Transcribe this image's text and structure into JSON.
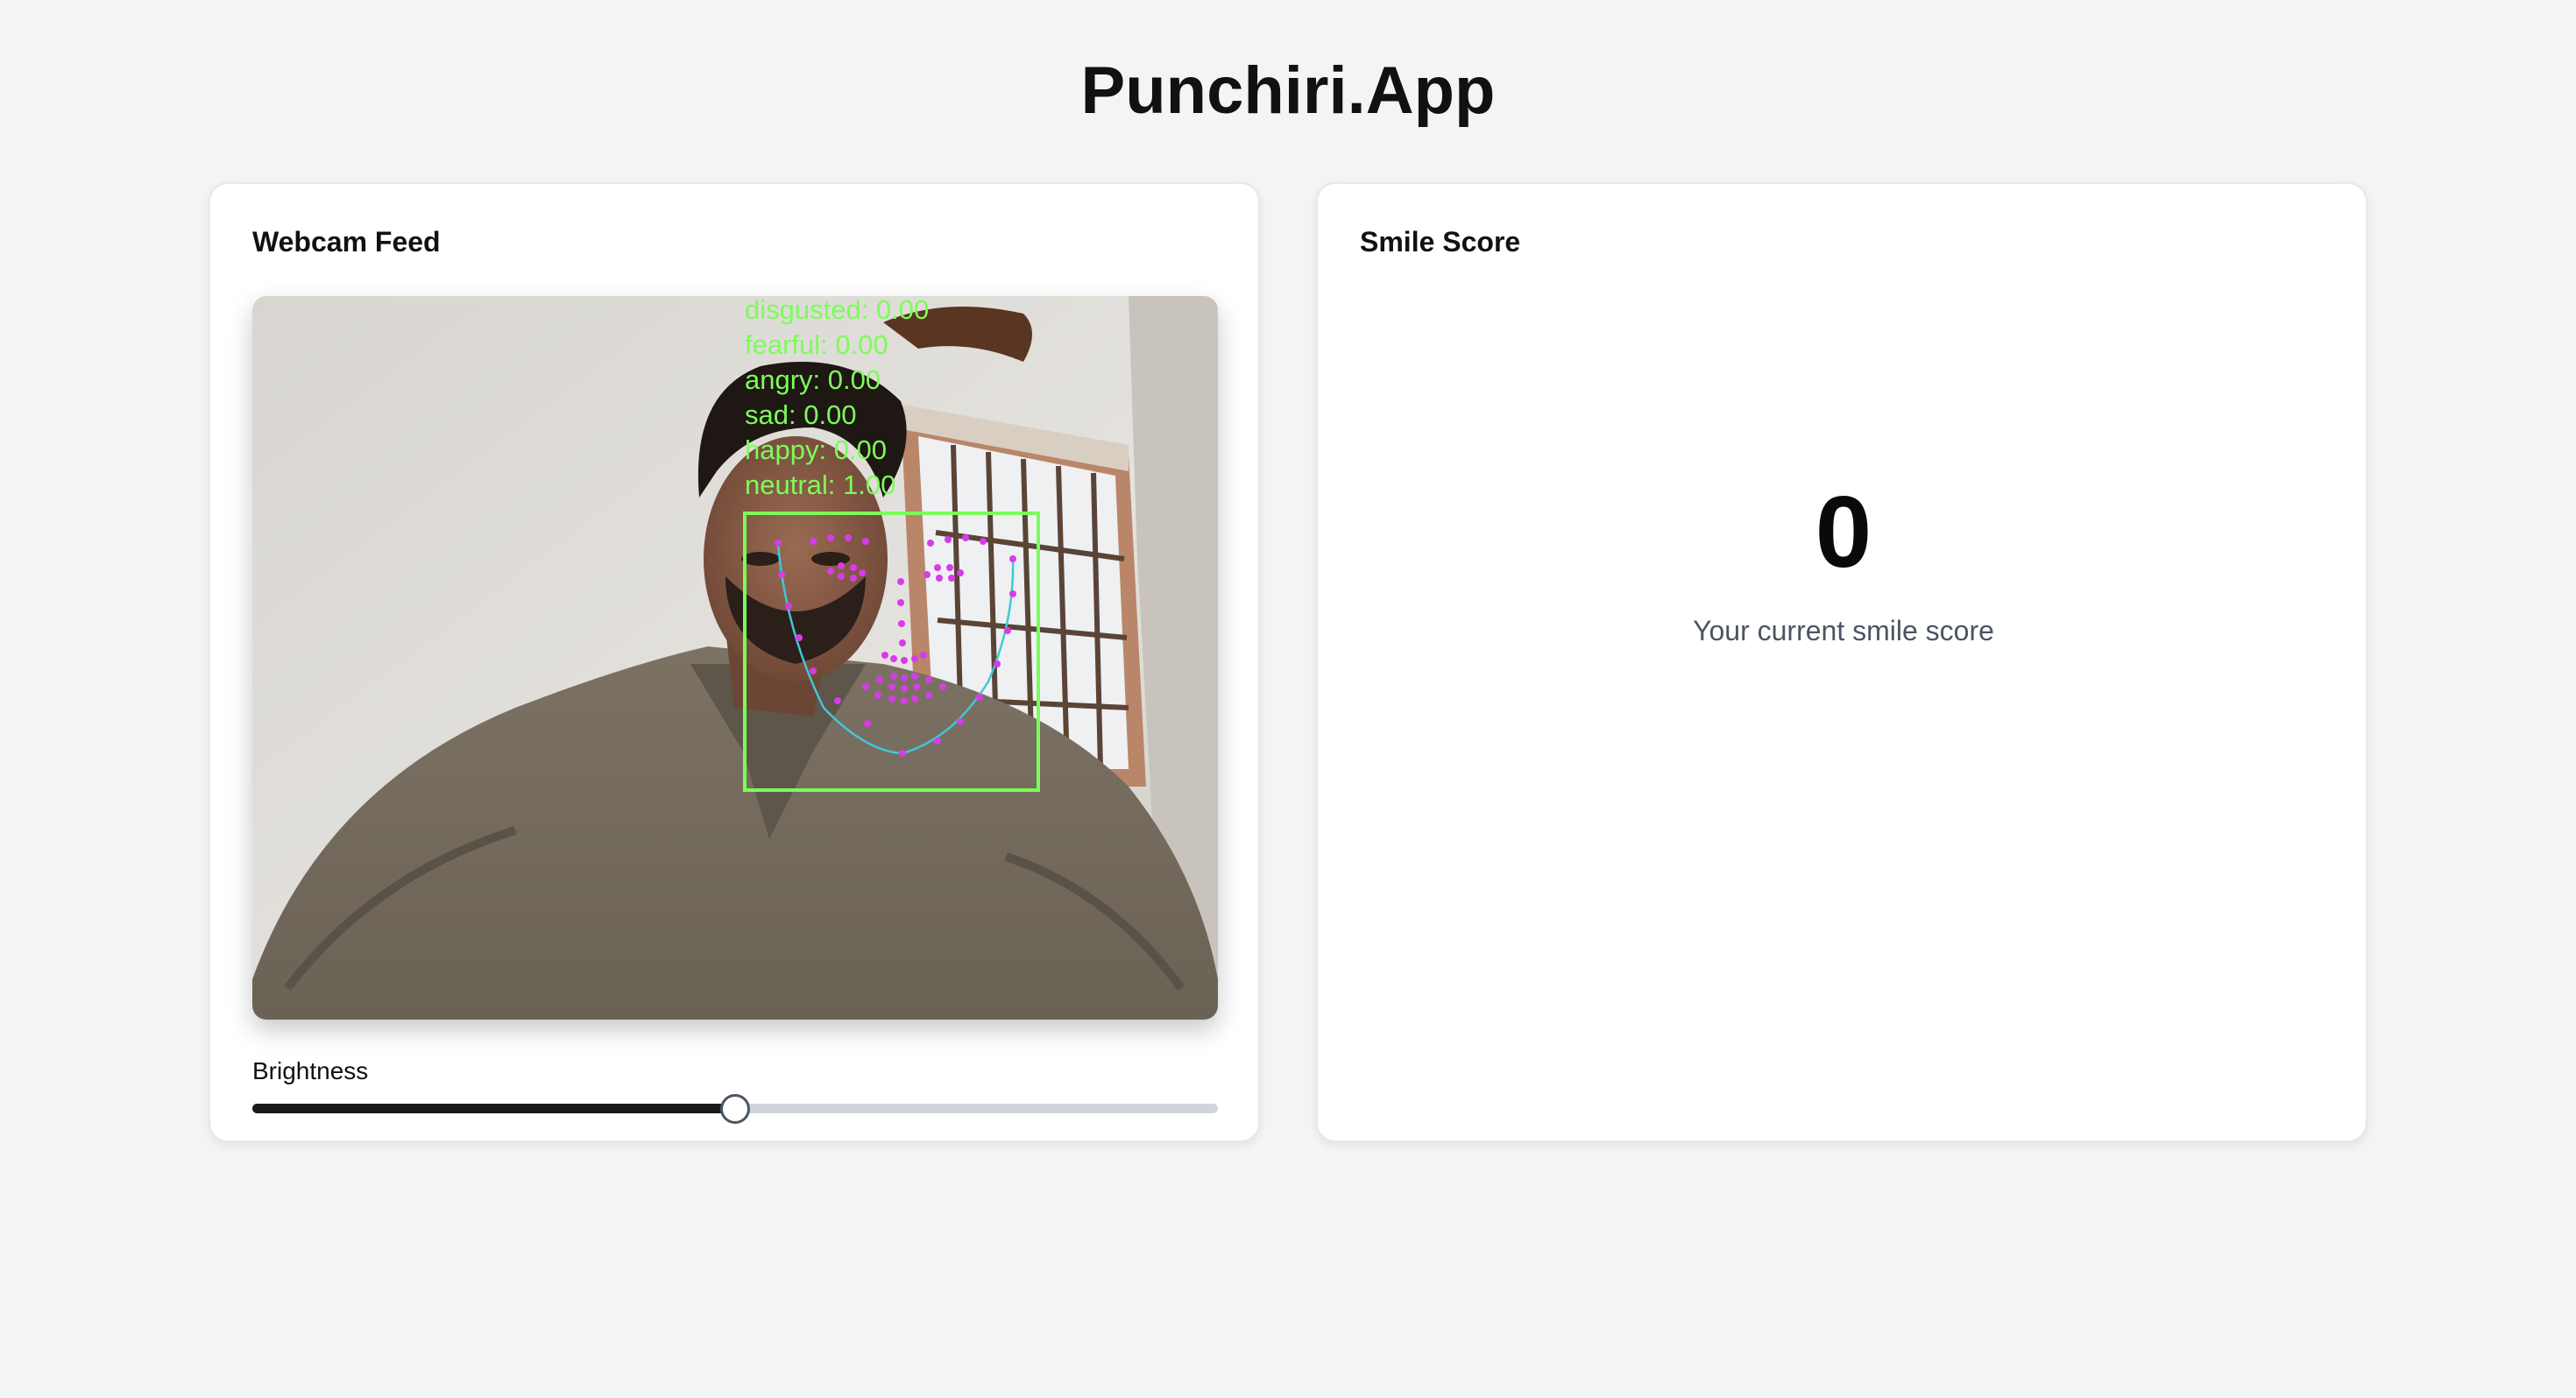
{
  "app": {
    "title": "Punchiri.App"
  },
  "webcam": {
    "title": "Webcam Feed",
    "emotions": [
      {
        "label": "disgusted: 0.00"
      },
      {
        "label": "fearful: 0.00"
      },
      {
        "label": "angry: 0.00"
      },
      {
        "label": "sad: 0.00"
      },
      {
        "label": "happy: 0.00"
      },
      {
        "label": "neutral: 1.00"
      }
    ],
    "overlay_colors": {
      "box": "#7CFC5A",
      "landmarks": "#d63ce8",
      "jaw": "#40c8d8"
    },
    "brightness": {
      "label": "Brightness",
      "value": 0.5
    }
  },
  "score": {
    "title": "Smile Score",
    "value": "0",
    "caption": "Your current smile score"
  }
}
